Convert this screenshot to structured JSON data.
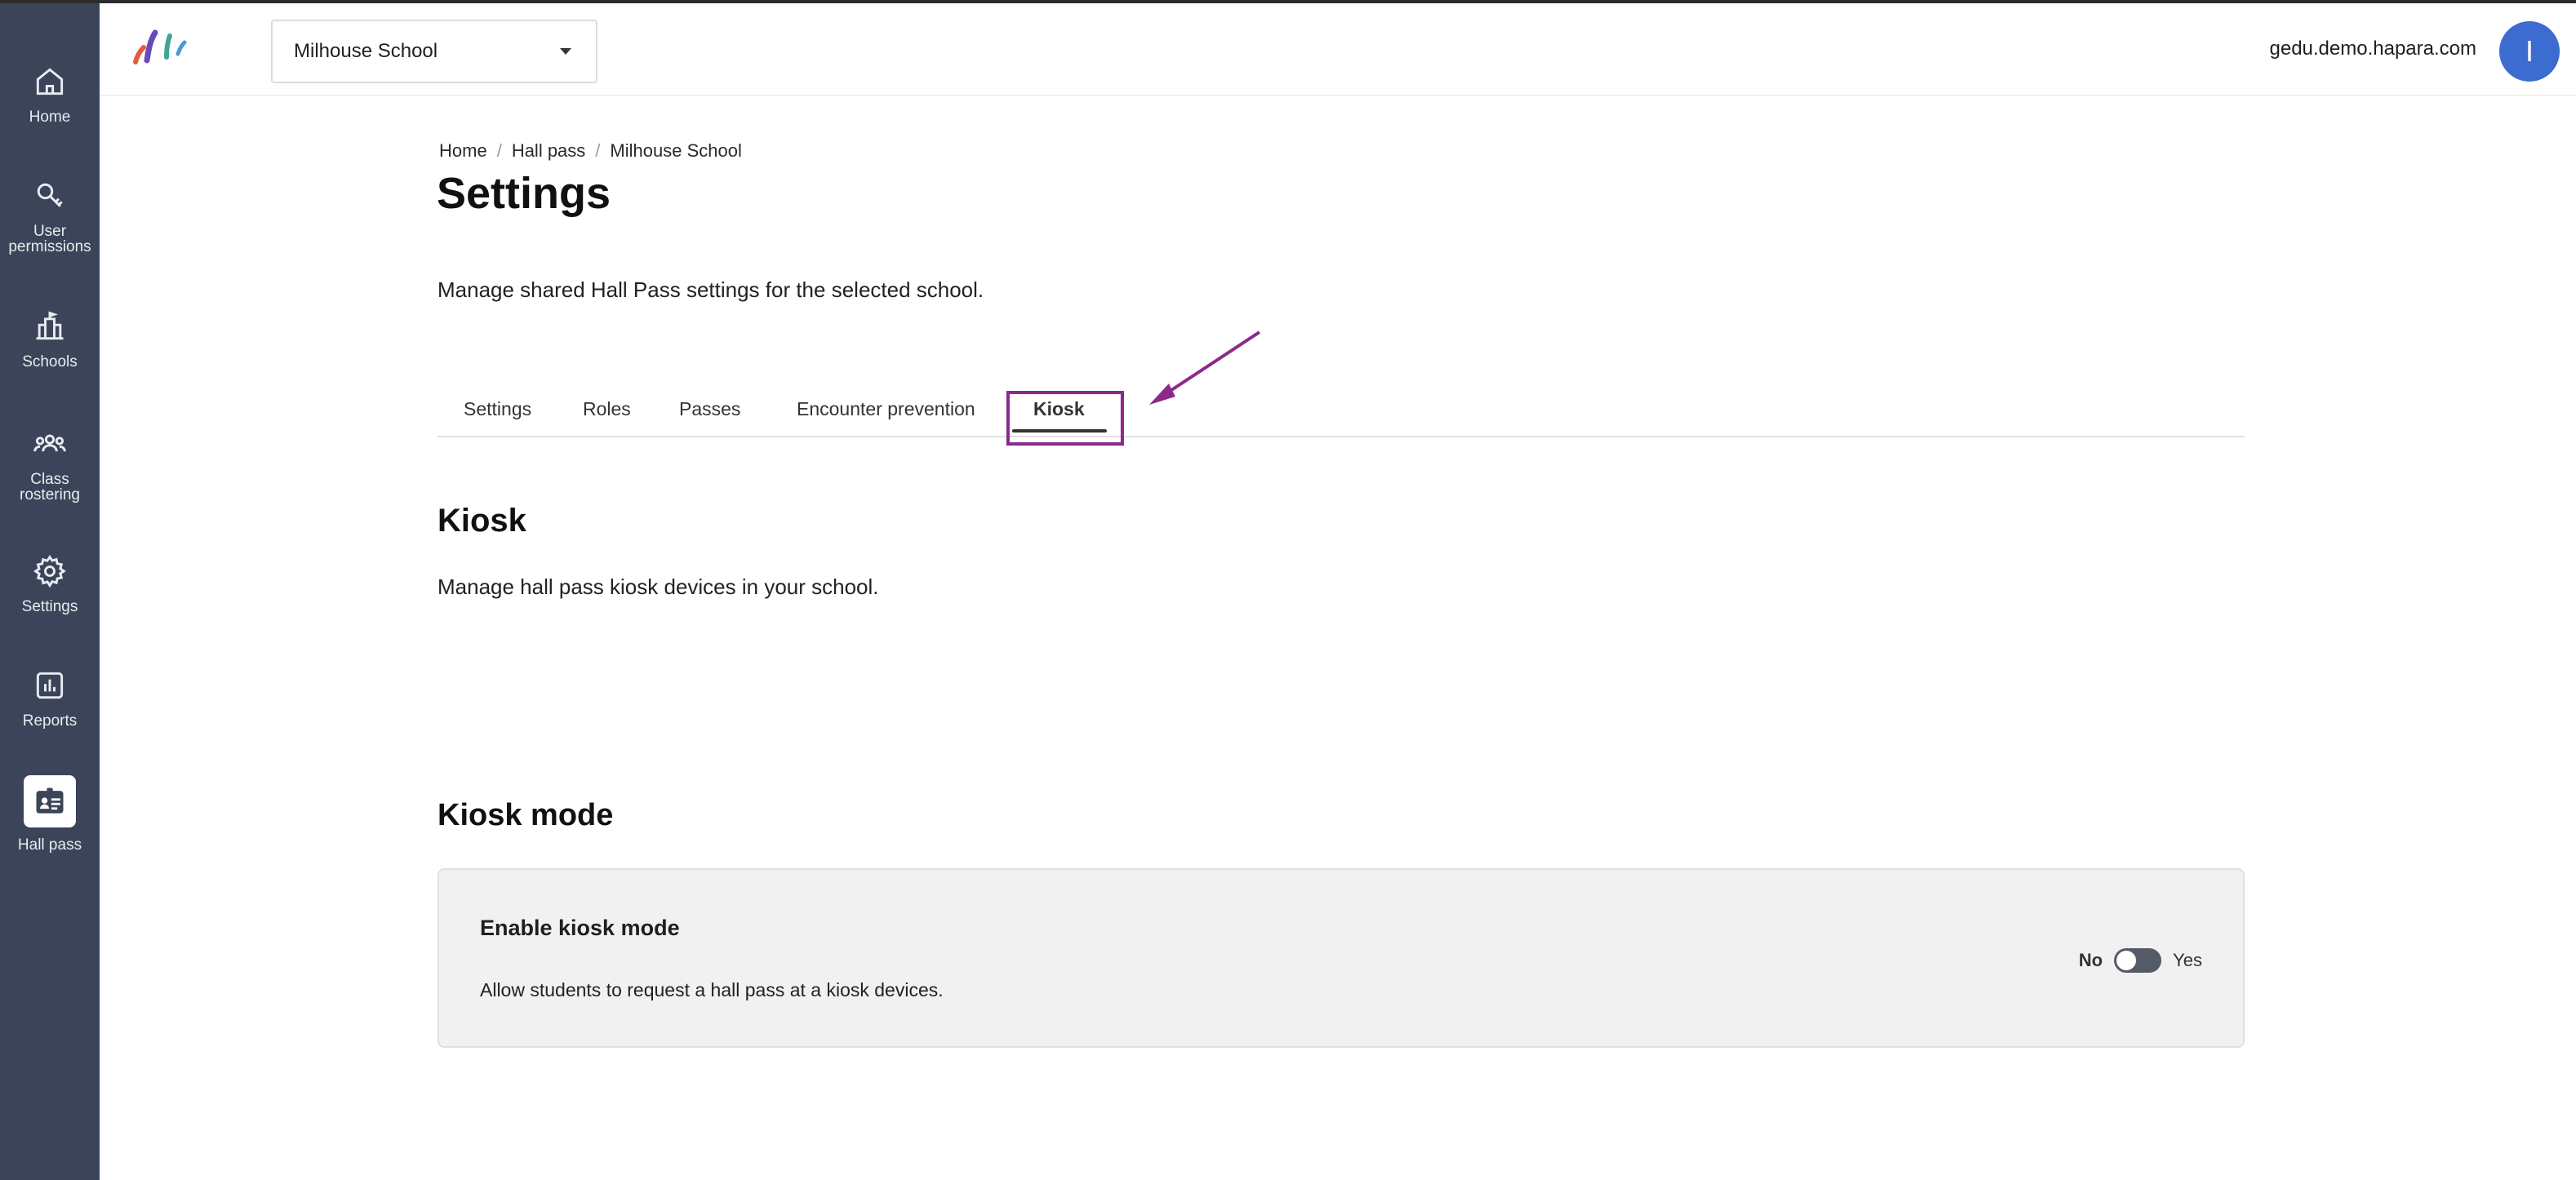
{
  "sidebar": {
    "items": [
      {
        "label": "Home",
        "icon": "home-icon"
      },
      {
        "label": "User\npermissions",
        "icon": "key-icon"
      },
      {
        "label": "Schools",
        "icon": "school-icon"
      },
      {
        "label": "Class\nrostering",
        "icon": "people-icon"
      },
      {
        "label": "Settings",
        "icon": "gear-icon"
      },
      {
        "label": "Reports",
        "icon": "chart-icon"
      },
      {
        "label": "Hall pass",
        "icon": "id-card-icon",
        "active": true
      }
    ]
  },
  "header": {
    "school_select": "Milhouse School",
    "domain": "gedu.demo.hapara.com",
    "avatar_initial": "I"
  },
  "breadcrumb": [
    "Home",
    "Hall pass",
    "Milhouse School"
  ],
  "page": {
    "title": "Settings",
    "description": "Manage shared Hall Pass settings for the selected school."
  },
  "tabs": [
    {
      "label": "Settings"
    },
    {
      "label": "Roles"
    },
    {
      "label": "Passes"
    },
    {
      "label": "Encounter prevention"
    },
    {
      "label": "Kiosk",
      "active": true
    }
  ],
  "kiosk": {
    "title": "Kiosk",
    "description": "Manage hall pass kiosk devices in your school."
  },
  "kiosk_mode": {
    "title": "Kiosk mode",
    "card_title": "Enable kiosk mode",
    "card_description": "Allow students to request a hall pass at a kiosk devices.",
    "toggle_no": "No",
    "toggle_yes": "Yes",
    "enabled": false
  },
  "colors": {
    "sidebar_bg": "#3b4458",
    "accent_purple": "#8b2a8b",
    "avatar_bg": "#3d6cd1"
  }
}
